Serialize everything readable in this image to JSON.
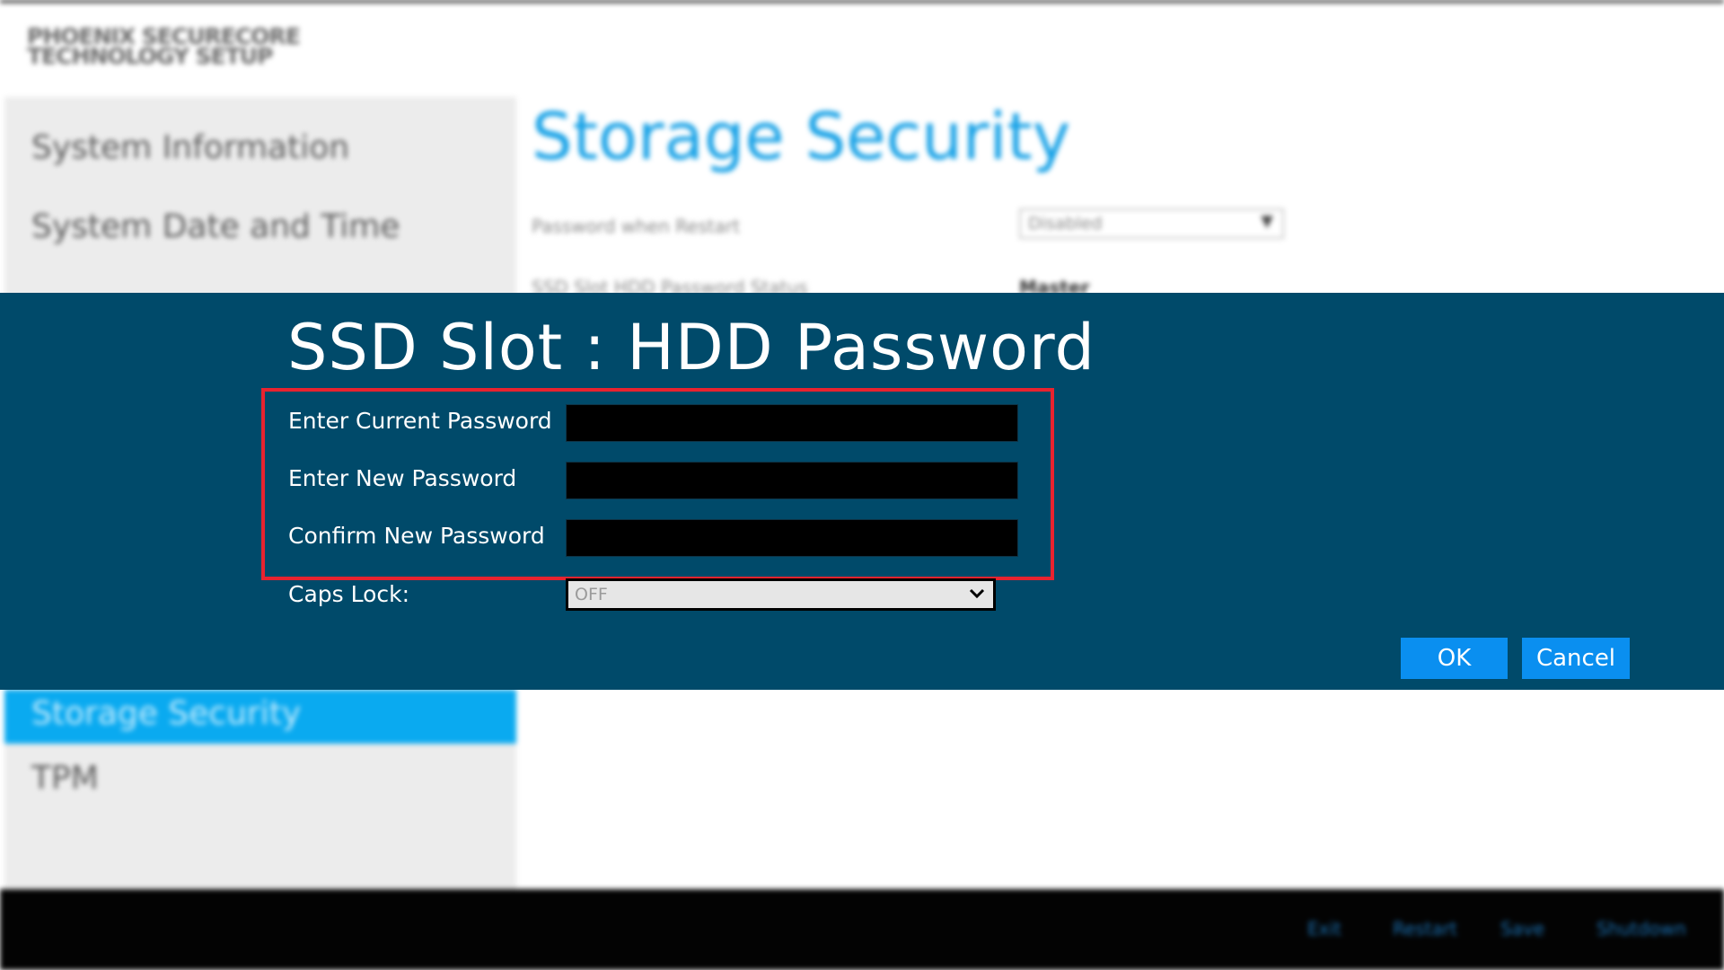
{
  "background": {
    "logo_lines": [
      "PHOENIX SECURECORE",
      "TECHNOLOGY SETUP"
    ],
    "sidebar": {
      "items": [
        "System Information",
        "System Date and Time",
        "Storage Security",
        "TPM"
      ],
      "active_item": "Storage Security"
    },
    "page_title": "Storage Security",
    "settings": [
      {
        "label": "Password when Restart",
        "value": "Disabled"
      },
      {
        "label": "SSD Slot HDD Password Status",
        "value": "Master"
      }
    ],
    "bottom_bar": [
      "Exit",
      "Restart",
      "Save",
      "Shutdown"
    ]
  },
  "dialog": {
    "title": "SSD Slot : HDD Password",
    "fields": [
      {
        "label": "Enter Current Password",
        "value": ""
      },
      {
        "label": "Enter New Password",
        "value": ""
      },
      {
        "label": "Confirm New Password",
        "value": ""
      }
    ],
    "caps_lock": {
      "label": "Caps Lock:",
      "value": "OFF"
    },
    "buttons": {
      "ok": "OK",
      "cancel": "Cancel"
    }
  },
  "colors": {
    "dialog_bg": "#004a6a",
    "accent_blue": "#0a8ff0",
    "highlight_red": "#e8232f",
    "title_blue": "#16a1e6"
  },
  "icons": [
    "chevron-down-icon"
  ]
}
